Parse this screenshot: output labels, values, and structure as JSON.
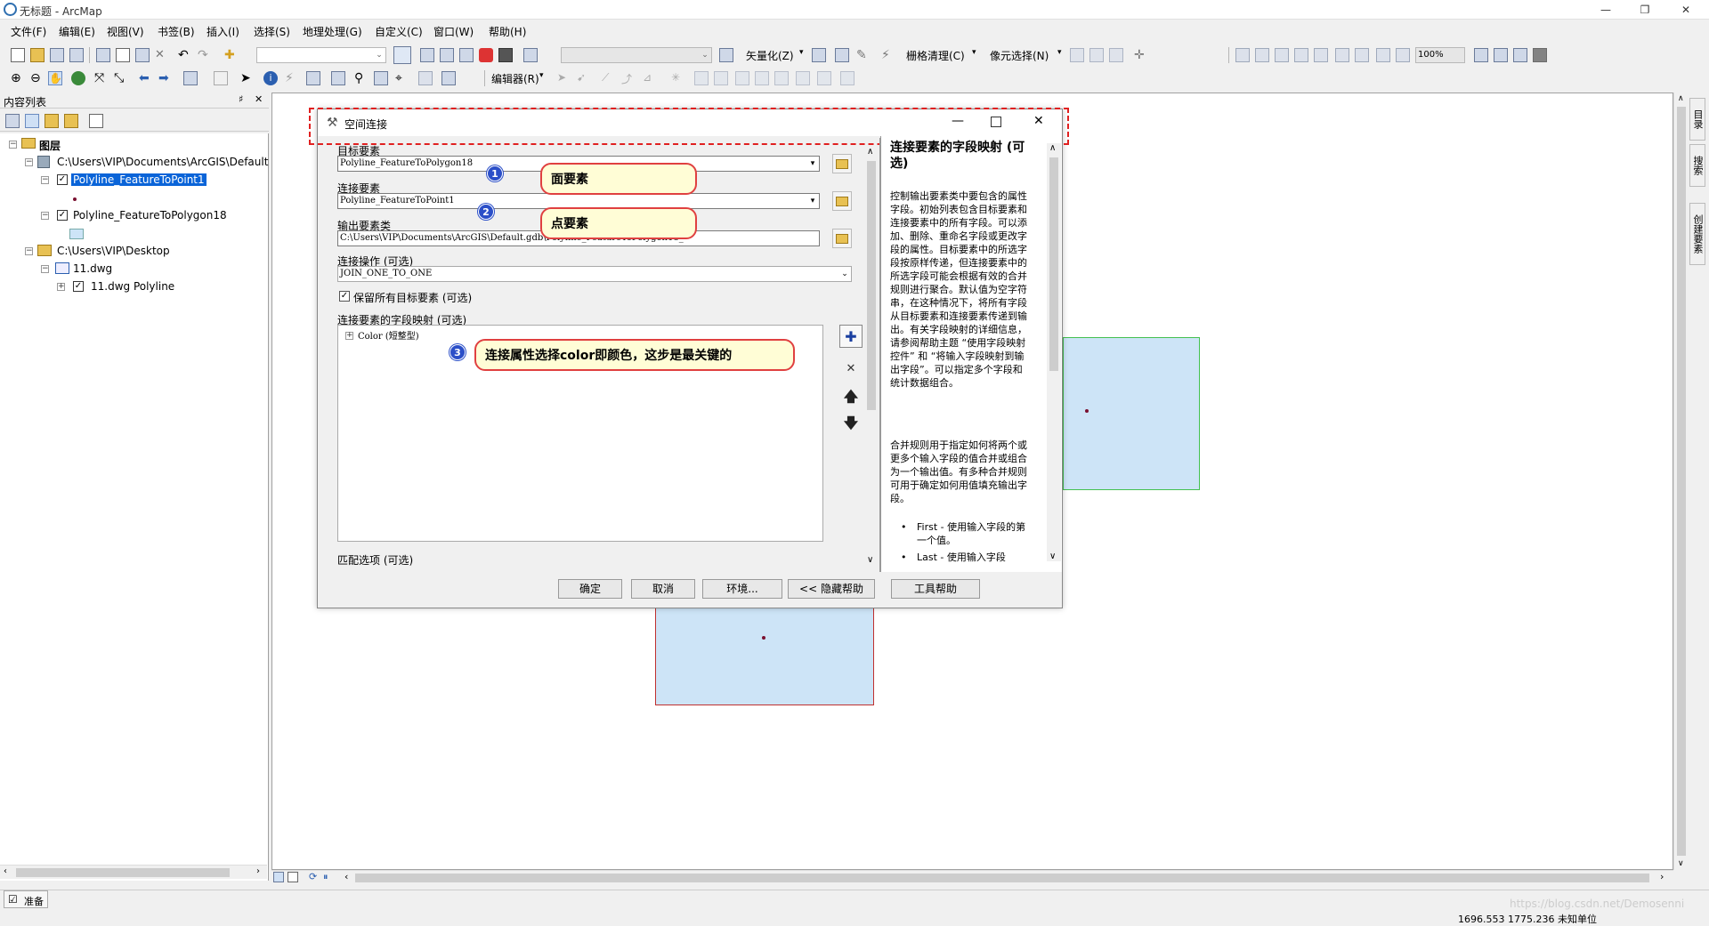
{
  "window": {
    "title": "无标题 - ArcMap",
    "min": "—",
    "max": "❐",
    "close": "✕"
  },
  "menu": [
    "文件(F)",
    "编辑(E)",
    "视图(V)",
    "书签(B)",
    "插入(I)",
    "选择(S)",
    "地理处理(G)",
    "自定义(C)",
    "窗口(W)",
    "帮助(H)"
  ],
  "toolbar": {
    "vectorize": "矢量化(Z)",
    "raster_clean": "栅格清理(C)",
    "cell_select": "像元选择(N)",
    "editor": "编辑器(R)",
    "zoom": "100%"
  },
  "toc": {
    "title": "内容列表",
    "pin": "♯",
    "close": "✕",
    "root": "图层",
    "items": [
      {
        "label": "C:\\Users\\VIP\\Documents\\ArcGIS\\Default"
      },
      {
        "label": "Polyline_FeatureToPoint1"
      },
      {
        "label": "Polyline_FeatureToPolygon18"
      },
      {
        "label": "C:\\Users\\VIP\\Desktop"
      },
      {
        "label": "11.dwg"
      },
      {
        "label": "11.dwg Polyline"
      }
    ]
  },
  "dialog": {
    "title": "空间连接",
    "target_label": "目标要素",
    "target_value": "Polyline_FeatureToPolygon18",
    "join_label": "连接要素",
    "join_value": "Polyline_FeatureToPoint1",
    "output_label": "输出要素类",
    "output_value": "C:\\Users\\VIP\\Documents\\ArcGIS\\Default.gdb\\Polyline_FeatureToPolygon18_",
    "operation_label": "连接操作 (可选)",
    "operation_value": "JOIN_ONE_TO_ONE",
    "keep_all_label": "保留所有目标要素 (可选)",
    "keep_all_checked": true,
    "fieldmap_label": "连接要素的字段映射 (可选)",
    "fieldmap_item": "Color (短整型)",
    "match_label": "匹配选项 (可选)",
    "buttons": {
      "ok": "确定",
      "cancel": "取消",
      "env": "环境...",
      "hide_help": "<< 隐藏帮助",
      "tool_help": "工具帮助"
    },
    "help": {
      "title": "连接要素的字段映射 (可选)",
      "para1": "控制输出要素类中要包含的属性字段。初始列表包含目标要素和连接要素中的所有字段。可以添加、删除、重命名字段或更改字段的属性。目标要素中的所选字段按原样传递，但连接要素中的所选字段可能会根据有效的合并规则进行聚合。默认值为空字符串，在这种情况下，将所有字段从目标要素和连接要素传递到输出。有关字段映射的详细信息，请参阅帮助主题 “使用字段映射控件” 和 “将输入字段映射到输出字段”。可以指定多个字段和统计数据组合。",
      "para2": "合并规则用于指定如何将两个或更多个输入字段的值合并或组合为一个输出值。有多种合并规则可用于确定如何用值填充输出字段。",
      "bullet1": "First - 使用输入字段的第一个值。",
      "bullet2": "Last - 使用输入字段"
    }
  },
  "callouts": [
    {
      "num": "1",
      "text": "面要素"
    },
    {
      "num": "2",
      "text": "点要素"
    },
    {
      "num": "3",
      "text": "连接属性选择color即颜色，这步是最关键的"
    }
  ],
  "status": {
    "ready": "准备",
    "coords": "1696.553  1775.236 未知单位",
    "watermark": "https://blog.csdn.net/Demosenni"
  },
  "right_tabs": [
    "目录",
    "搜索",
    "创建要素"
  ],
  "colors": {
    "polygon_fill": "#cde4f7",
    "highlight_red": "#e02020",
    "selection_blue": "#0a64d8"
  }
}
